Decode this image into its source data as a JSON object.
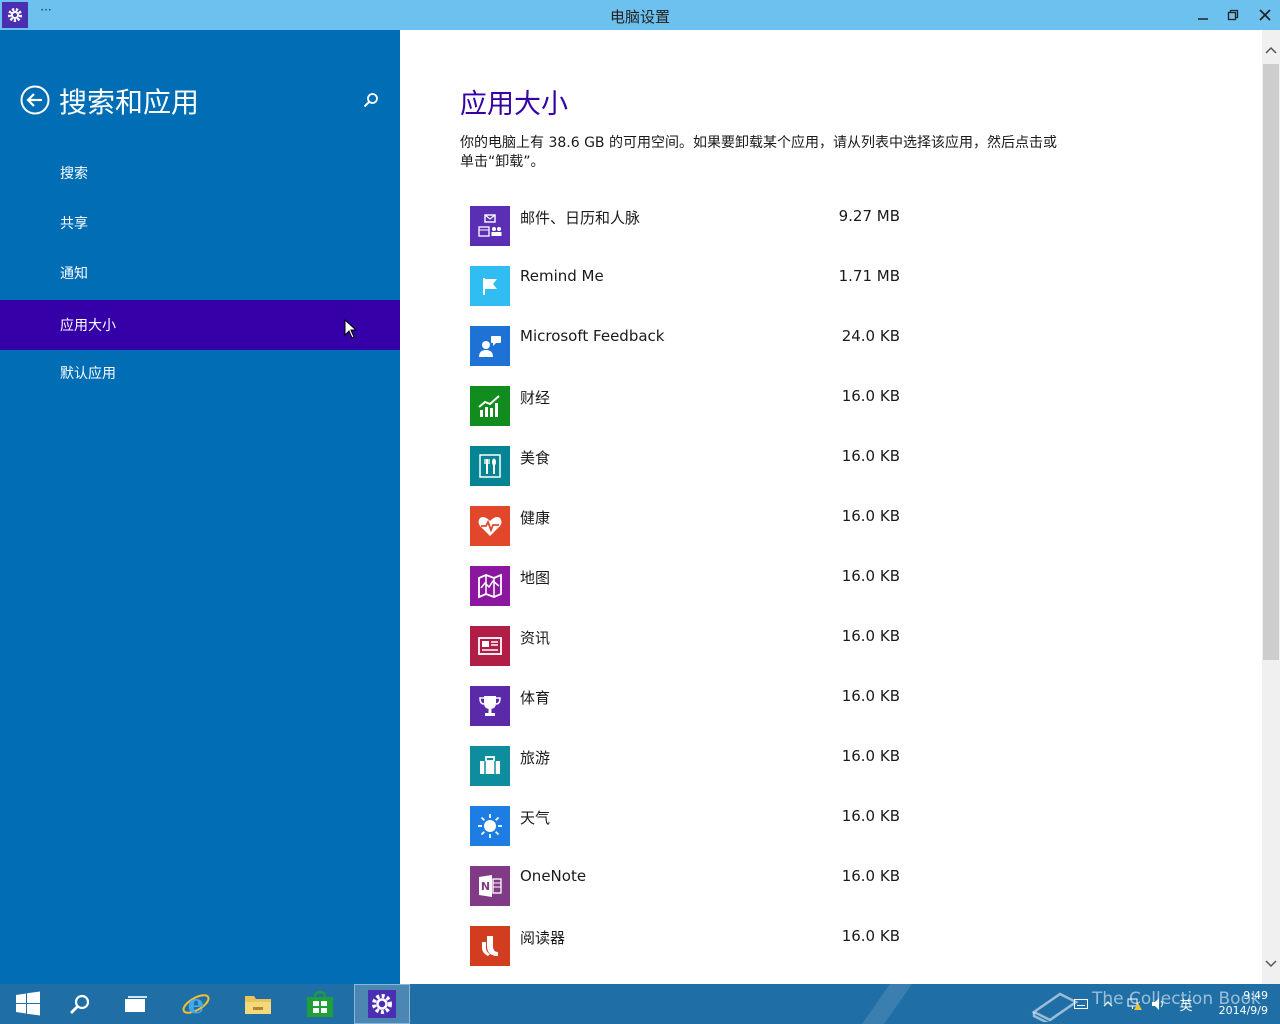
{
  "window": {
    "title": "电脑设置",
    "menu_glyph": "···"
  },
  "sidebar": {
    "title": "搜索和应用",
    "items": [
      {
        "label": "搜索"
      },
      {
        "label": "共享"
      },
      {
        "label": "通知"
      },
      {
        "label": "应用大小",
        "active": true
      },
      {
        "label": "默认应用"
      }
    ],
    "bg_color": "#006db5",
    "active_color": "#3500a7"
  },
  "main": {
    "title": "应用大小",
    "description": "你的电脑上有 38.6 GB 的可用空间。如果要卸载某个应用，请从列表中选择该应用，然后点击或单击“卸载”。",
    "apps": [
      {
        "name": "邮件、日历和人脉",
        "size": "9.27 MB",
        "icon": "mail-calendar-people-icon",
        "color": "#5b2fb3"
      },
      {
        "name": "Remind Me",
        "size": "1.71 MB",
        "icon": "flag-icon",
        "color": "#2fbdf2"
      },
      {
        "name": "Microsoft Feedback",
        "size": "24.0 KB",
        "icon": "feedback-icon",
        "color": "#1e72d6"
      },
      {
        "name": "财经",
        "size": "16.0 KB",
        "icon": "finance-chart-icon",
        "color": "#118c1e"
      },
      {
        "name": "美食",
        "size": "16.0 KB",
        "icon": "fork-spoon-icon",
        "color": "#058593"
      },
      {
        "name": "健康",
        "size": "16.0 KB",
        "icon": "heart-pulse-icon",
        "color": "#e2462b"
      },
      {
        "name": "地图",
        "size": "16.0 KB",
        "icon": "map-icon",
        "color": "#8b16a0"
      },
      {
        "name": "资讯",
        "size": "16.0 KB",
        "icon": "newspaper-icon",
        "color": "#b01e45"
      },
      {
        "name": "体育",
        "size": "16.0 KB",
        "icon": "trophy-icon",
        "color": "#5a2aa8"
      },
      {
        "name": "旅游",
        "size": "16.0 KB",
        "icon": "suitcase-icon",
        "color": "#0d8d9d"
      },
      {
        "name": "天气",
        "size": "16.0 KB",
        "icon": "sun-icon",
        "color": "#1d7de3"
      },
      {
        "name": "OneNote",
        "size": "16.0 KB",
        "icon": "onenote-icon",
        "color": "#813a86"
      },
      {
        "name": "阅读器",
        "size": "16.0 KB",
        "icon": "reader-icon",
        "color": "#d23d1f"
      }
    ]
  },
  "taskbar": {
    "items": [
      "start-icon",
      "search-icon",
      "task-view-icon",
      "internet-explorer-icon",
      "file-explorer-icon",
      "store-icon",
      "settings-icon"
    ],
    "clock_time": "9:49",
    "clock_date": "2014/9/9",
    "ime_label": "英",
    "watermark": "The Collection Book"
  }
}
